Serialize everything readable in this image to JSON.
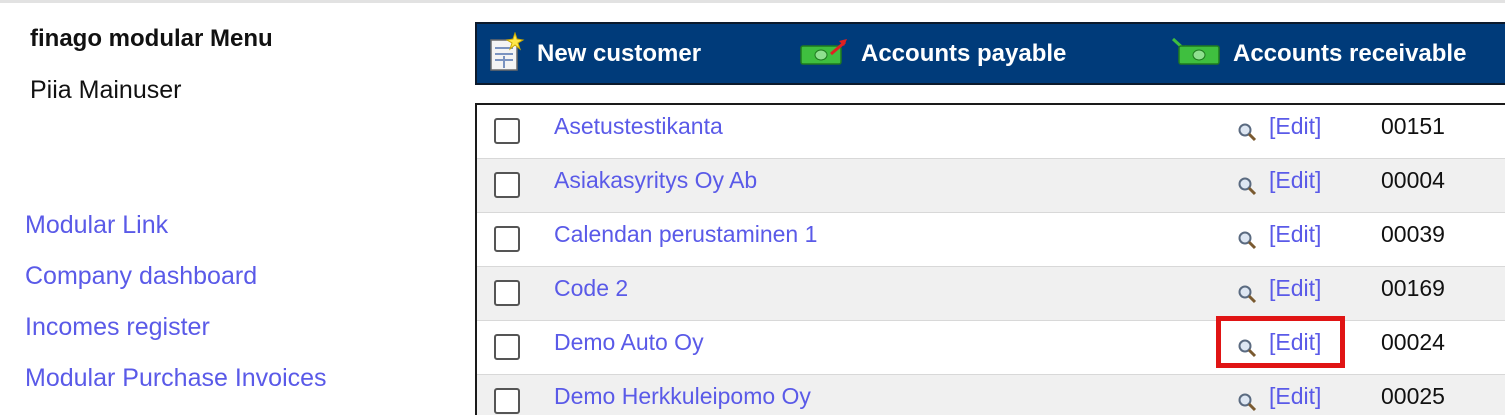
{
  "menu": {
    "title": "finago modular Menu",
    "user": "Piia Mainuser",
    "links": [
      "Modular Link",
      "Company dashboard",
      "Incomes register",
      "Modular Purchase Invoices"
    ]
  },
  "toolbar": {
    "new_customer": "New customer",
    "accounts_payable": "Accounts payable",
    "accounts_receivable": "Accounts receivable"
  },
  "customers": [
    {
      "name": "Asetustestikanta",
      "edit": "[Edit]",
      "code": "00151"
    },
    {
      "name": "Asiakasyritys Oy Ab",
      "edit": "[Edit]",
      "code": "00004"
    },
    {
      "name": "Calendan perustaminen 1",
      "edit": "[Edit]",
      "code": "00039"
    },
    {
      "name": "Code 2",
      "edit": "[Edit]",
      "code": "00169"
    },
    {
      "name": "Demo Auto Oy",
      "edit": "[Edit]",
      "code": "00024"
    },
    {
      "name": "Demo Herkkuleipomo Oy",
      "edit": "[Edit]",
      "code": "00025"
    }
  ],
  "colors": {
    "link": "#5a5ae8",
    "toolbar_bg": "#003b7a",
    "highlight": "#e01414"
  }
}
